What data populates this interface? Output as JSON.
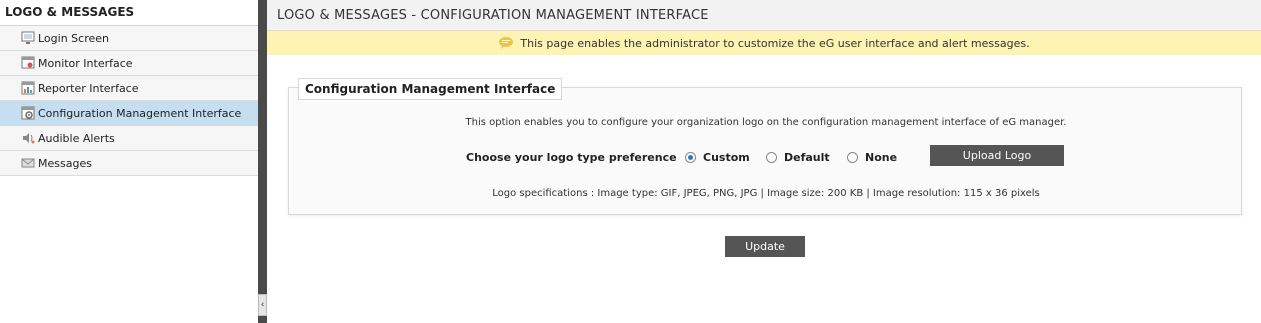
{
  "sidebar": {
    "header": "LOGO & MESSAGES",
    "items": [
      {
        "label": "Login Screen",
        "icon": "monitor-icon"
      },
      {
        "label": "Monitor Interface",
        "icon": "monitor-interface-icon"
      },
      {
        "label": "Reporter Interface",
        "icon": "reporter-chart-icon"
      },
      {
        "label": "Configuration Management Interface",
        "icon": "config-gear-icon",
        "active": true
      },
      {
        "label": "Audible Alerts",
        "icon": "speaker-icon"
      },
      {
        "label": "Messages",
        "icon": "envelope-icon"
      }
    ],
    "collapse_glyph": "‹"
  },
  "main": {
    "title": "LOGO & MESSAGES - CONFIGURATION MANAGEMENT INTERFACE",
    "info": "This page enables the administrator to customize the eG user interface and alert messages.",
    "panel": {
      "legend": "Configuration Management Interface",
      "description": "This option enables you to configure your organization logo on the configuration management interface of eG manager.",
      "preference_label": "Choose your logo type preference",
      "options": [
        {
          "label": "Custom",
          "selected": true
        },
        {
          "label": "Default",
          "selected": false
        },
        {
          "label": "None",
          "selected": false
        }
      ],
      "upload_label": "Upload Logo",
      "specs": "Logo specifications : Image type: GIF, JPEG, PNG, JPG | Image size: 200 KB | Image resolution: 115 x 36 pixels"
    },
    "update_label": "Update"
  },
  "colors": {
    "sidebar_active": "#c5dff0",
    "info_bg": "#fdf3b3",
    "button": "#555555",
    "splitter": "#4a4a4a"
  }
}
